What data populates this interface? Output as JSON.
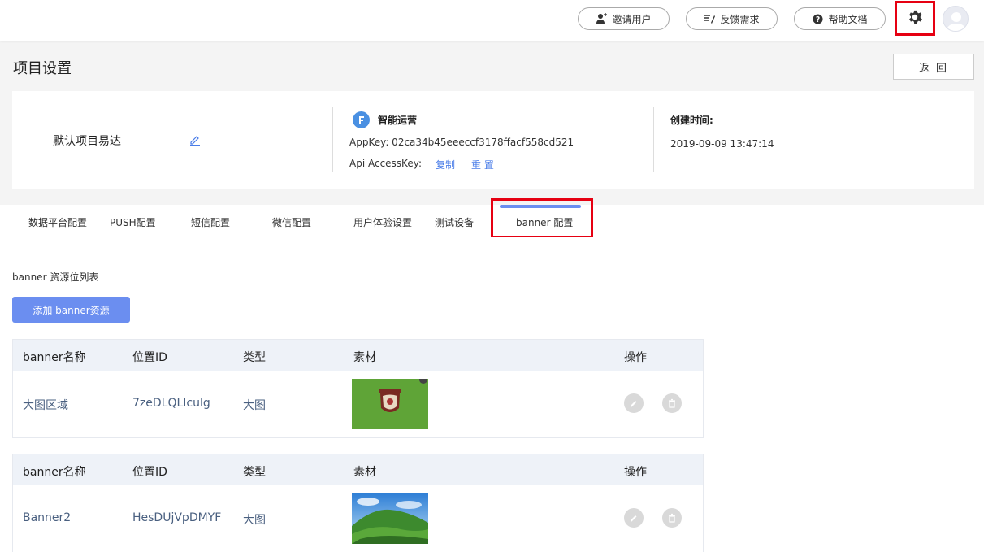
{
  "topbar": {
    "invite_label": "邀请用户",
    "feedback_label": "反馈需求",
    "help_label": "帮助文档",
    "icons": [
      "user-plus-icon",
      "feedback-icon",
      "question-icon",
      "gear-icon"
    ]
  },
  "page": {
    "title": "项目设置",
    "back_label": "返 回"
  },
  "project": {
    "name": "默认项目易达",
    "service_name": "智能运营",
    "appkey_text": "AppKey: 02ca34b45eeeccf3178ffacf558cd521",
    "accesskey_label": "Api AccessKey:",
    "copy_label": "复制",
    "reset_label": "重 置",
    "created_label": "创建时间:",
    "created_value": "2019-09-09 13:47:14"
  },
  "tabs": [
    {
      "label": "数据平台配置"
    },
    {
      "label": "PUSH配置"
    },
    {
      "label": "短信配置"
    },
    {
      "label": "微信配置"
    },
    {
      "label": "用户体验设置"
    },
    {
      "label": "测试设备"
    },
    {
      "label": "banner 配置",
      "active": true
    }
  ],
  "content": {
    "section_title": "banner 资源位列表",
    "add_button_label": "添加 banner资源",
    "columns": [
      "banner名称",
      "位置ID",
      "类型",
      "素材",
      "操作"
    ],
    "rows": [
      {
        "name": "大图区域",
        "position_id": "7zeDLQLIculg",
        "type": "大图",
        "material": "green-badge-image"
      },
      {
        "name": "Banner2",
        "position_id": "HesDUjVpDMYF",
        "type": "大图",
        "material": "mountain-landscape-image"
      }
    ]
  },
  "colors": {
    "accent": "#6b8ef0",
    "highlight_box": "#e60012",
    "link": "#4a7de8"
  }
}
